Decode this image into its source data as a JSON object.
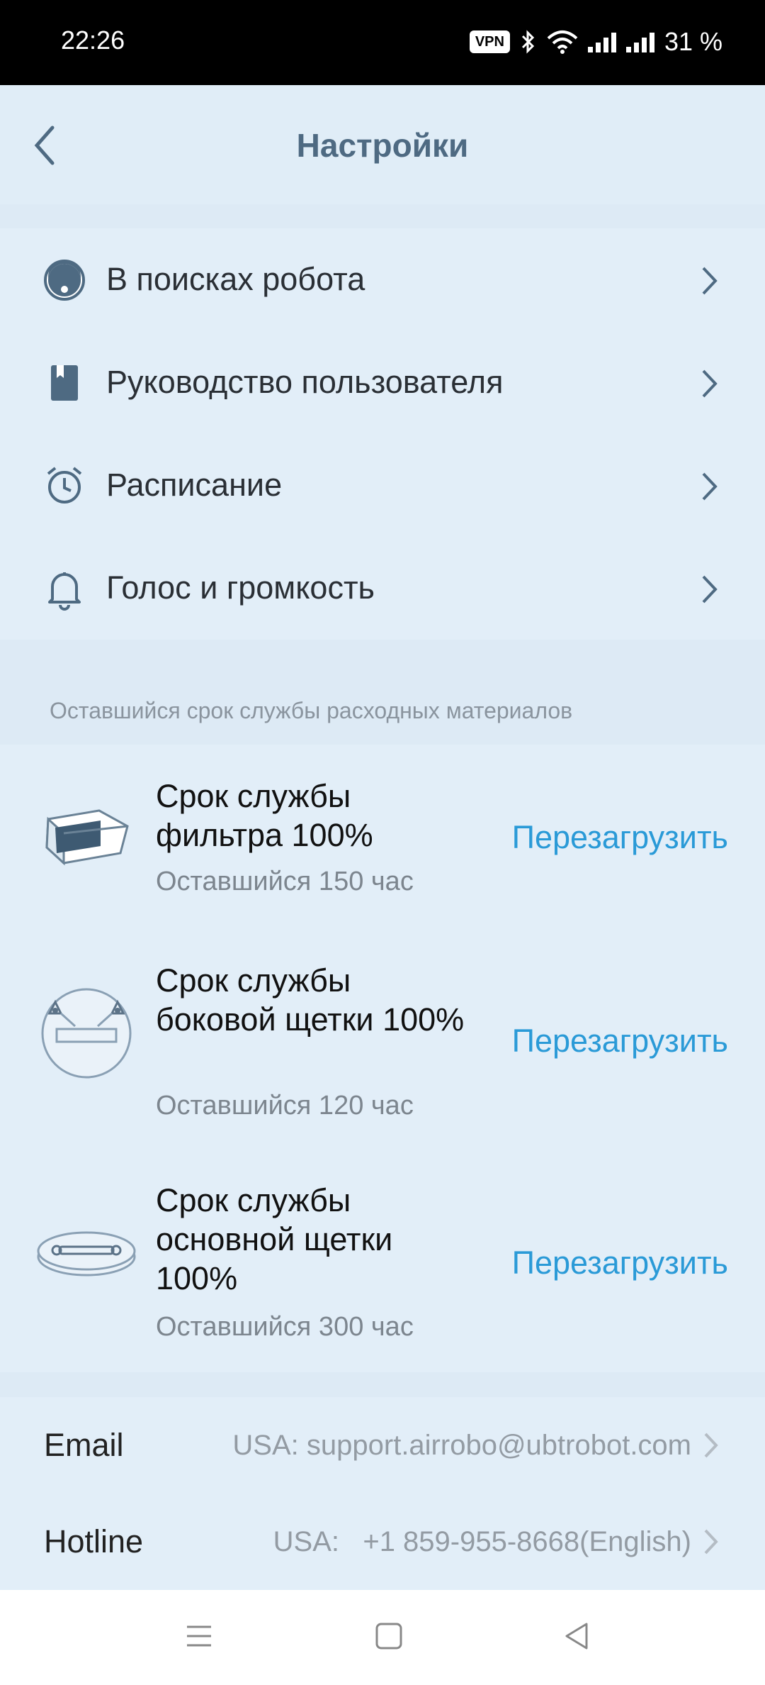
{
  "status_bar": {
    "time": "22:26",
    "vpn_label": "VPN",
    "battery": "31 %"
  },
  "header": {
    "title": "Настройки"
  },
  "menu": [
    {
      "icon": "robot-icon",
      "label": "В поисках робота"
    },
    {
      "icon": "book-icon",
      "label": "Руководство пользователя"
    },
    {
      "icon": "alarm-clock-icon",
      "label": "Расписание"
    },
    {
      "icon": "bell-icon",
      "label": "Голос и громкость"
    }
  ],
  "consumables": {
    "section_title": "Оставшийся срок службы расходных материалов",
    "items": [
      {
        "icon": "filter-icon",
        "name": "Срок службы фильтра 100%",
        "remaining": "Оставшийся 150 час",
        "action": "Перезагрузить",
        "percent": 100
      },
      {
        "icon": "side-brush-icon",
        "name": "Срок службы боковой щетки 100%",
        "remaining": "Оставшийся 120 час",
        "action": "Перезагрузить",
        "percent": 100
      },
      {
        "icon": "main-brush-icon",
        "name": "Срок службы основной щетки 100%",
        "remaining": "Оставшийся 300 час",
        "action": "Перезагрузить",
        "percent": 100
      }
    ]
  },
  "contacts": [
    {
      "key": "Email",
      "value": "USA: support.airrobo@ubtrobot.com"
    },
    {
      "key": "Hotline",
      "value": "USA:   +1 859-955-8668(English)"
    }
  ],
  "colors": {
    "accent": "#2a9ad7",
    "header_title": "#4e6a82",
    "background": "#ddeaf5"
  }
}
